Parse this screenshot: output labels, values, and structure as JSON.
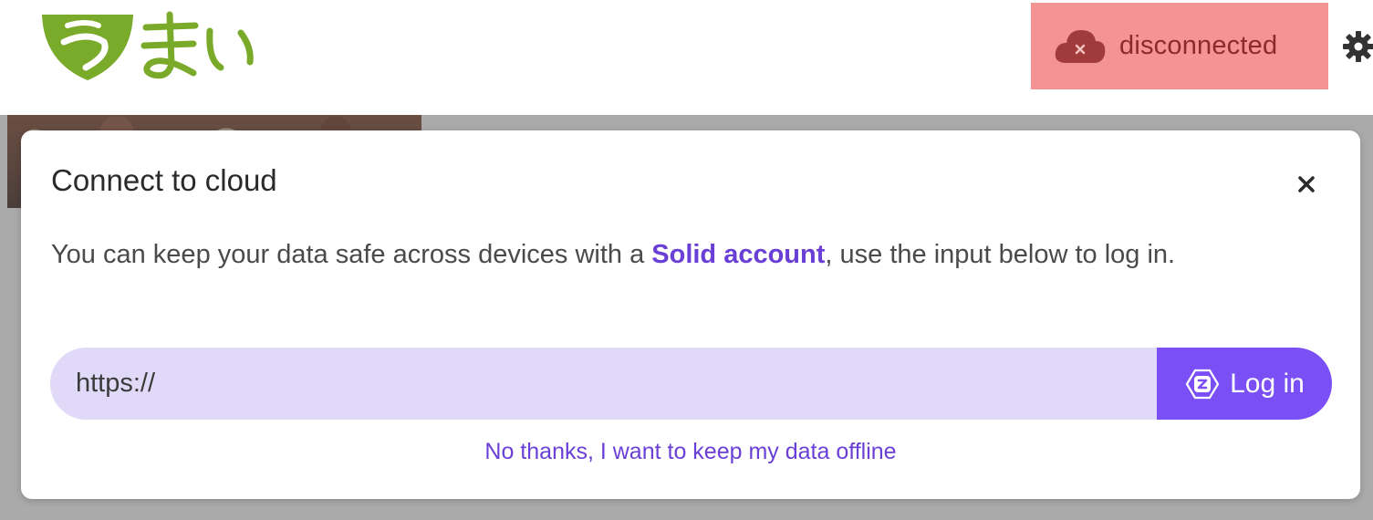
{
  "header": {
    "status": {
      "label": "disconnected",
      "icon": "cloud-x-icon",
      "color": "#f49393"
    },
    "settings_icon": "gear-icon"
  },
  "modal": {
    "title": "Connect to cloud",
    "close_icon": "close-icon",
    "description_before": "You can keep your data safe across devices with a ",
    "description_link": "Solid account",
    "description_after": ", use the input below to log in.",
    "url_input": {
      "value": "https://",
      "placeholder": ""
    },
    "login_button": {
      "label": "Log in",
      "icon": "solid-icon",
      "color": "#7a4ff5"
    },
    "offline_link": "No thanks, I want to keep my data offline"
  },
  "colors": {
    "brand_green": "#7aaa2a",
    "accent_purple": "#6a3fd6",
    "input_bg": "#e0d9f8",
    "backdrop": "#aaaaaa"
  }
}
